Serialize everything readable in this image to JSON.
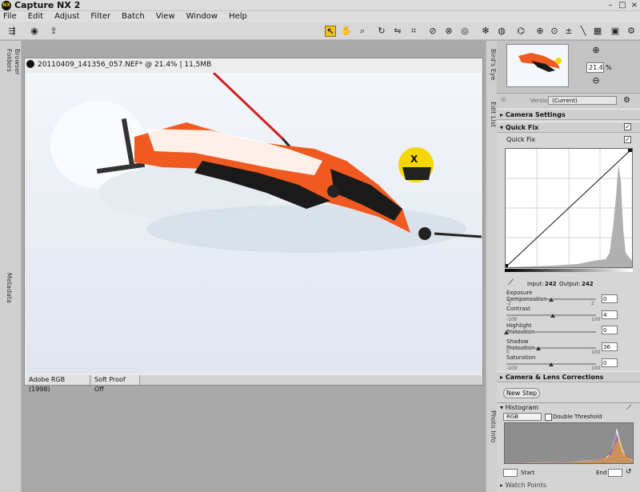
{
  "app": {
    "title": "Capture NX 2",
    "logo": "NX"
  },
  "window_controls": {
    "minimize": "–",
    "maximize": "□",
    "close": "×"
  },
  "menu": [
    "File",
    "Edit",
    "Adjust",
    "Filter",
    "Batch",
    "View",
    "Window",
    "Help"
  ],
  "left_tabs": [
    "Folders",
    "Browser",
    "Metadata"
  ],
  "document": {
    "title": "20110409_141356_057.NEF* @ 21.4% | 11,5MB",
    "color_profile": "Adobe RGB (1998)",
    "soft_proof": "Soft Proof Off"
  },
  "right_tabs": [
    "Bird's Eye",
    "Edit List",
    "Photo Info"
  ],
  "birds_eye": {
    "zoom_value": "21.4",
    "zoom_unit": "%"
  },
  "edit_list": {
    "version_label": "Version",
    "version_value": "(Current)",
    "camera_settings": "Camera Settings",
    "quick_fix": "Quick Fix",
    "quick_fix_sub": "Quick Fix",
    "input_label": "Input:",
    "input_value": "242",
    "output_label": "Output:",
    "output_value": "242",
    "params": [
      {
        "label": "Exposure Compensation",
        "min": "-2",
        "max": "2",
        "value": "0",
        "fraction": 0.5
      },
      {
        "label": "Contrast",
        "min": "-100",
        "max": "100",
        "value": "4",
        "fraction": 0.52
      },
      {
        "label": "Highlight Protection",
        "min": "",
        "max": "",
        "value": "0",
        "fraction": 0.0
      },
      {
        "label": "Shadow Protection",
        "min": "0",
        "max": "100",
        "value": "36",
        "fraction": 0.36
      },
      {
        "label": "Saturation",
        "min": "-100",
        "max": "100",
        "value": "0",
        "fraction": 0.5
      }
    ],
    "camera_lens": "Camera & Lens Corrections",
    "new_step": "New Step"
  },
  "histogram_panel": {
    "title": "Histogram",
    "channel": "RGB",
    "double_threshold": "Double Threshold",
    "start_label": "Start",
    "end_label": "End",
    "start_value": "",
    "end_value": ""
  },
  "watch_points": "Watch Points",
  "colors": {
    "accent": "#f0c020",
    "panel": "#d6d6d6",
    "canvas": "#a9a9a9"
  }
}
